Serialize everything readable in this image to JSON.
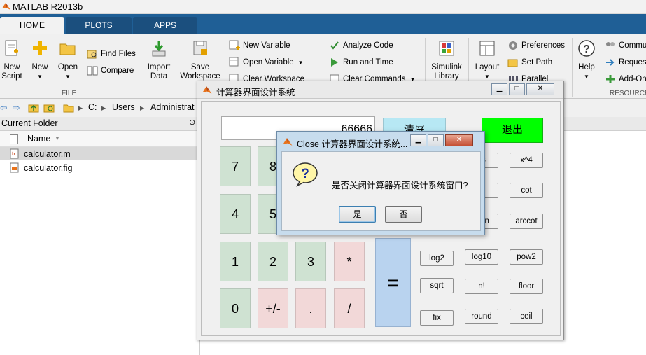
{
  "app": {
    "title": "MATLAB R2013b"
  },
  "tabs": [
    {
      "label": "HOME"
    },
    {
      "label": "PLOTS"
    },
    {
      "label": "APPS"
    }
  ],
  "ribbon": {
    "new_script": "New Script",
    "new_script_l1": "New",
    "new_script_l2": "Script",
    "new": "New",
    "open": "Open",
    "find_files": "Find Files",
    "compare": "Compare",
    "import_data_l1": "Import",
    "import_data_l2": "Data",
    "save_ws_l1": "Save",
    "save_ws_l2": "Workspace",
    "new_variable": "New Variable",
    "open_variable": "Open Variable",
    "clear_workspace": "Clear Workspace",
    "analyze_code": "Analyze Code",
    "run_and_time": "Run and Time",
    "clear_commands": "Clear Commands",
    "simulink_l1": "Simulink",
    "simulink_l2": "Library",
    "layout": "Layout",
    "preferences": "Preferences",
    "set_path": "Set Path",
    "parallel": "Parallel",
    "help": "Help",
    "community": "Commu",
    "request_support": "Reques",
    "add_ons": "Add-On",
    "group_file": "FILE",
    "group_resources": "RESOURCES"
  },
  "address": {
    "drive": "C:",
    "sep": "▸",
    "users": "Users",
    "admin": "Administrat"
  },
  "current_folder": {
    "title": "Current Folder",
    "column_name": "Name",
    "files": [
      {
        "name": "calculator.m"
      },
      {
        "name": "calculator.fig"
      }
    ]
  },
  "calc_window": {
    "title": "计算器界面设计系统",
    "display_value": "66666",
    "clear_label": "清屏",
    "exit_label": "退出",
    "digit_keys": [
      "7",
      "8",
      "4",
      "5",
      "1",
      "2",
      "3",
      "*",
      "0",
      "+/-",
      ".",
      "/"
    ],
    "equals_label": "=",
    "fn_keys": {
      "x3": "^3",
      "x4": "x^4",
      "tan_partial": "n",
      "cot": "cot",
      "arctan_partial": "ctan",
      "arccot": "arccot",
      "log2": "log2",
      "log10": "log10",
      "pow2": "pow2",
      "sqrt": "sqrt",
      "factorial": "n!",
      "floor": "floor",
      "fix": "fix",
      "round": "round",
      "ceil": "ceil"
    }
  },
  "dialog": {
    "title": "Close 计算器界面设计系统...",
    "message": "是否关闭计算器界面设计系统窗口?",
    "yes_label": "是",
    "no_label": "否",
    "icon_glyph": "?"
  },
  "colors": {
    "exit_green": "#00ff00",
    "clear_cyan": "#b7e8f4",
    "key_green": "#cfe2d2",
    "key_pink": "#f2d8d8",
    "equals_blue": "#b9d3ef",
    "tabbar_blue": "#1f5f96"
  }
}
